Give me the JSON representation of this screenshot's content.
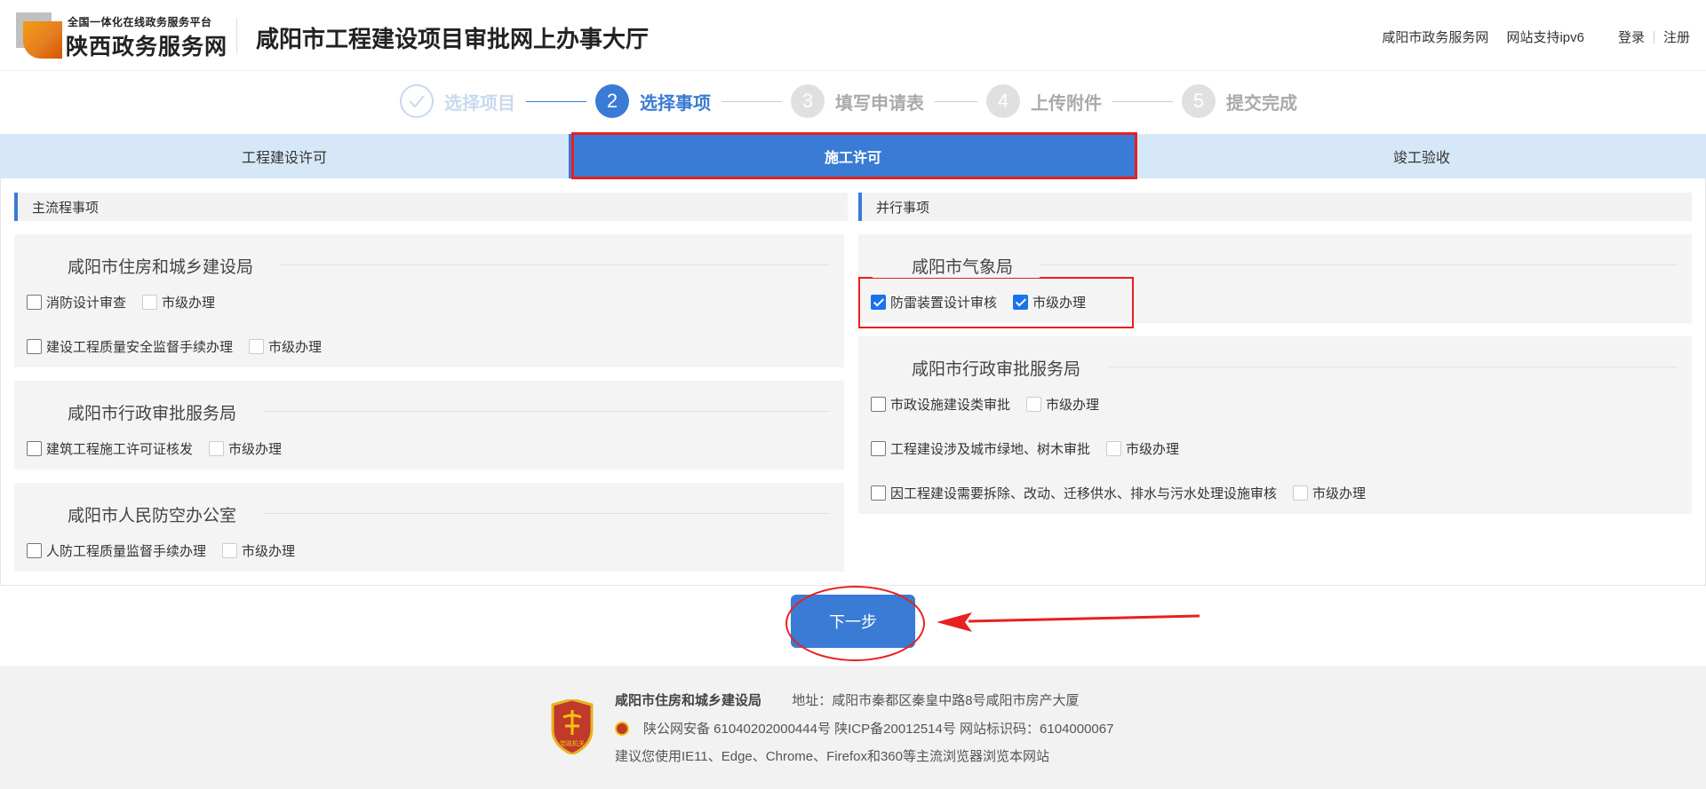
{
  "header": {
    "brand_small": "全国一体化在线政务服务平台",
    "brand_big": "陕西政务服务网",
    "hall_title": "咸阳市工程建设项目审批网上办事大厅",
    "links": [
      "咸阳市政务服务网",
      "网站支持ipv6",
      "登录",
      "注册"
    ]
  },
  "steps": [
    {
      "num": "✓",
      "label": "选择项目",
      "state": "done"
    },
    {
      "num": "2",
      "label": "选择事项",
      "state": "active"
    },
    {
      "num": "3",
      "label": "填写申请表",
      "state": "pending"
    },
    {
      "num": "4",
      "label": "上传附件",
      "state": "pending"
    },
    {
      "num": "5",
      "label": "提交完成",
      "state": "pending"
    }
  ],
  "tabs": [
    "工程建设许可",
    "施工许可",
    "竣工验收"
  ],
  "left": {
    "heading": "主流程事项",
    "panels": [
      {
        "title": "咸阳市住房和城乡建设局",
        "items": [
          {
            "label": "消防设计审查",
            "city": "市级办理"
          },
          {
            "label": "建设工程质量安全监督手续办理",
            "city": "市级办理"
          }
        ]
      },
      {
        "title": "咸阳市行政审批服务局",
        "items": [
          {
            "label": "建筑工程施工许可证核发",
            "city": "市级办理"
          }
        ]
      },
      {
        "title": "咸阳市人民防空办公室",
        "items": [
          {
            "label": "人防工程质量监督手续办理",
            "city": "市级办理"
          }
        ]
      }
    ]
  },
  "right": {
    "heading": "并行事项",
    "panels": [
      {
        "title": "咸阳市气象局",
        "items": [
          {
            "label": "防雷装置设计审核",
            "city": "市级办理",
            "checked": true
          }
        ]
      },
      {
        "title": "咸阳市行政审批服务局",
        "items": [
          {
            "label": "市政设施建设类审批",
            "city": "市级办理"
          },
          {
            "label": "工程建设涉及城市绿地、树木审批",
            "city": "市级办理"
          },
          {
            "label": "因工程建设需要拆除、改动、迁移供水、排水与污水处理设施审核",
            "city": "市级办理"
          }
        ]
      }
    ]
  },
  "next_button": "下一步",
  "footer": {
    "org": "咸阳市住房和城乡建设局",
    "address": "地址：咸阳市秦都区秦皇中路8号咸阳市房产大厦",
    "record": "陕公网安备 61040202000444号 陕ICP备20012514号 网站标识码：6104000067",
    "browser_tip": "建议您使用IE11、Edge、Chrome、Firefox和360等主流浏览器浏览本网站",
    "emblem_text": "党政机关"
  },
  "colors": {
    "primary": "#3a7bd5",
    "annotation_red": "#e8201f",
    "tab_bg": "#d6e8f8",
    "panel_bg": "#f4f4f4"
  }
}
